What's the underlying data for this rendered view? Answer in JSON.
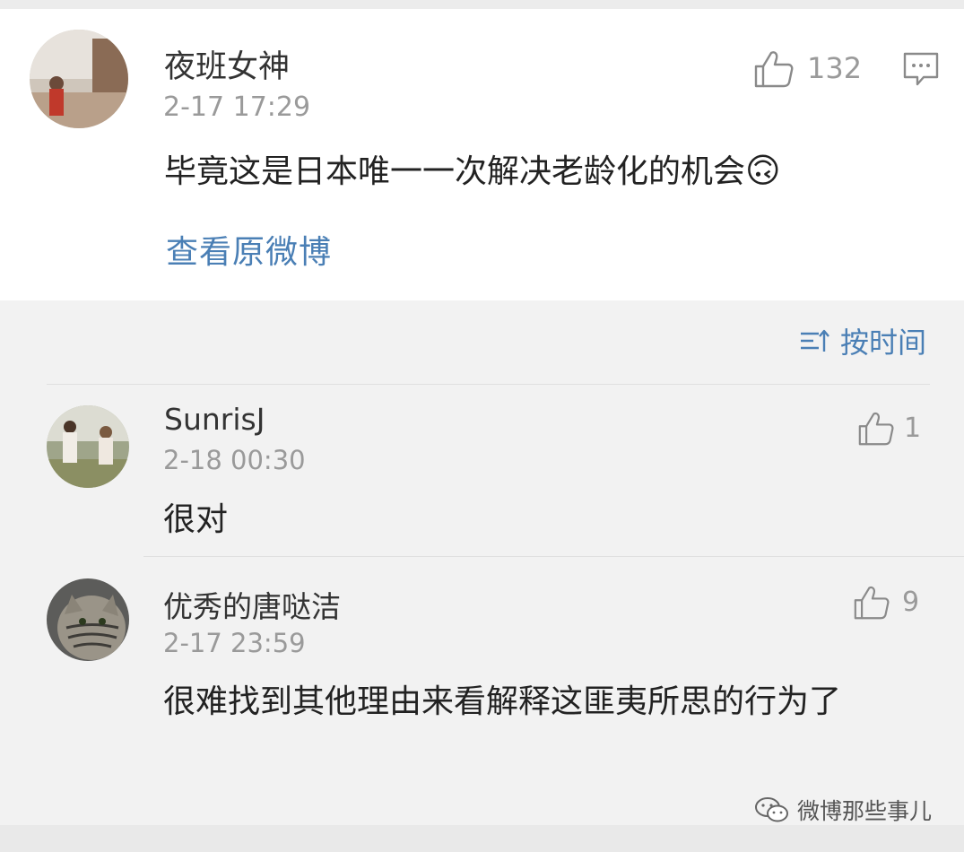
{
  "main_comment": {
    "username": "夜班女神",
    "timestamp": "2-17 17:29",
    "text": "毕竟这是日本唯一一次解决老龄化的机会",
    "emoji": "🙃",
    "like_count": "132",
    "view_original_label": "查看原微博"
  },
  "sort": {
    "label": "按时间"
  },
  "replies": [
    {
      "username": "SunrisJ",
      "timestamp": "2-18 00:30",
      "text": "很对",
      "like_count": "1"
    },
    {
      "username": "优秀的唐哒洁",
      "timestamp": "2-17 23:59",
      "text": "很难找到其他理由来看解释这匪夷所思的行为了",
      "like_count": "9"
    }
  ],
  "watermark": {
    "label": "微博那些事儿"
  },
  "colors": {
    "link": "#4a7fb5",
    "muted": "#9a9a9a",
    "text": "#222222",
    "background": "#f2f2f2"
  }
}
